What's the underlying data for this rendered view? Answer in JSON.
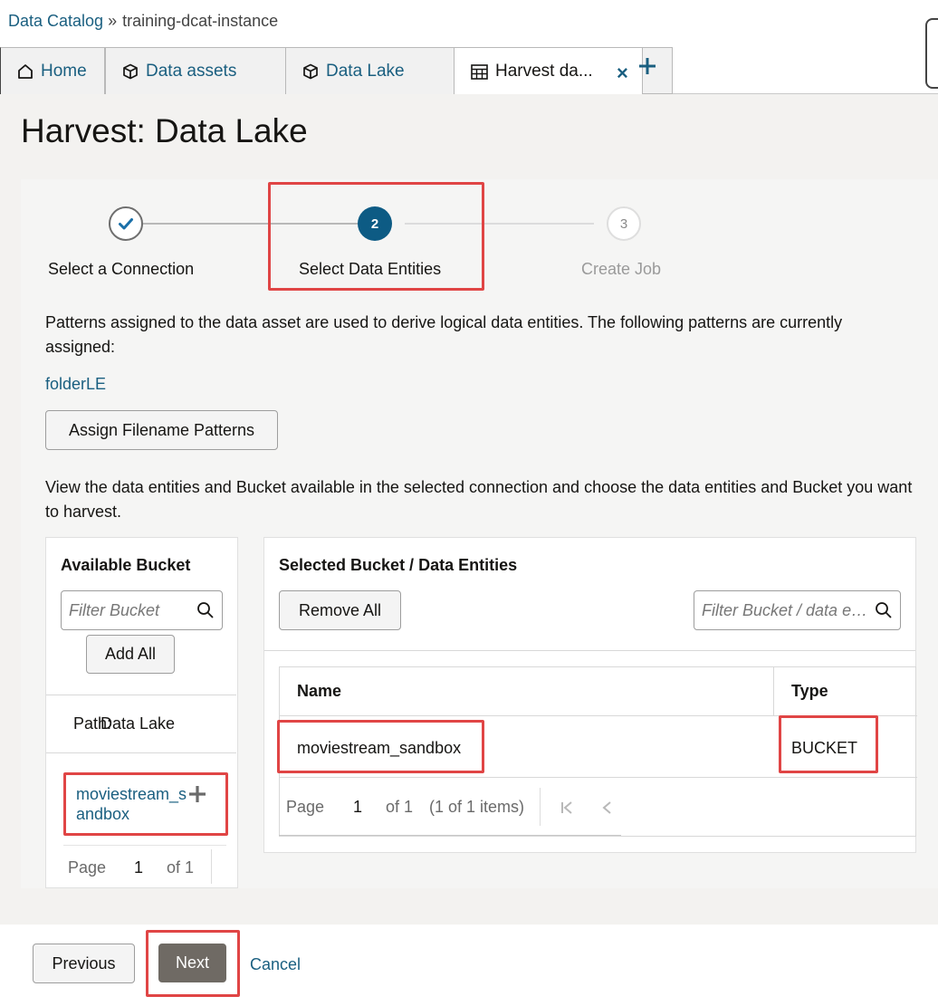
{
  "breadcrumb": {
    "root": "Data Catalog",
    "separator": "»",
    "current": "training-dcat-instance"
  },
  "tabs": [
    {
      "label": "Home",
      "icon": "home-icon"
    },
    {
      "label": "Data assets",
      "icon": "cube-icon"
    },
    {
      "label": "Data Lake",
      "icon": "cube-icon"
    },
    {
      "label": "Harvest da...",
      "icon": "table-icon",
      "active": true
    }
  ],
  "tab_close": "×",
  "page": {
    "title": "Harvest: Data Lake"
  },
  "wizard": {
    "steps": [
      {
        "number": "1",
        "label": "Select a Connection",
        "state": "complete"
      },
      {
        "number": "2",
        "label": "Select Data Entities",
        "state": "current"
      },
      {
        "number": "3",
        "label": "Create Job",
        "state": "pending"
      }
    ],
    "patterns_intro": "Patterns assigned to the data asset are used to derive logical data entities. The following patterns are currently assigned:",
    "pattern_name": "folderLE",
    "assign_button": "Assign Filename Patterns",
    "entities_intro": "View the data entities and Bucket available in the selected connection and choose the data entities and Bucket you want to harvest."
  },
  "available": {
    "title": "Available Bucket",
    "filter_placeholder": "Filter Bucket",
    "add_all": "Add All",
    "path_label": "Path:",
    "path_value": "Data Lake",
    "items": [
      {
        "name": "moviestream_sandbox"
      }
    ],
    "pager": {
      "page_label": "Page",
      "page": "1",
      "of": "of 1"
    }
  },
  "selected": {
    "title": "Selected Bucket / Data Entities",
    "remove_all": "Remove All",
    "filter_placeholder": "Filter Bucket / data entities",
    "columns": [
      "Name",
      "Type"
    ],
    "rows": [
      {
        "name": "moviestream_sandbox",
        "type": "BUCKET"
      }
    ],
    "pager": {
      "page_label": "Page",
      "page": "1",
      "of": "of 1",
      "items": "(1 of 1 items)"
    }
  },
  "footer": {
    "previous": "Previous",
    "next": "Next",
    "cancel": "Cancel"
  },
  "colors": {
    "accent": "#0d5b84",
    "link": "#1a5f80",
    "highlight": "#e04545",
    "primary_button": "#6f6a64"
  }
}
